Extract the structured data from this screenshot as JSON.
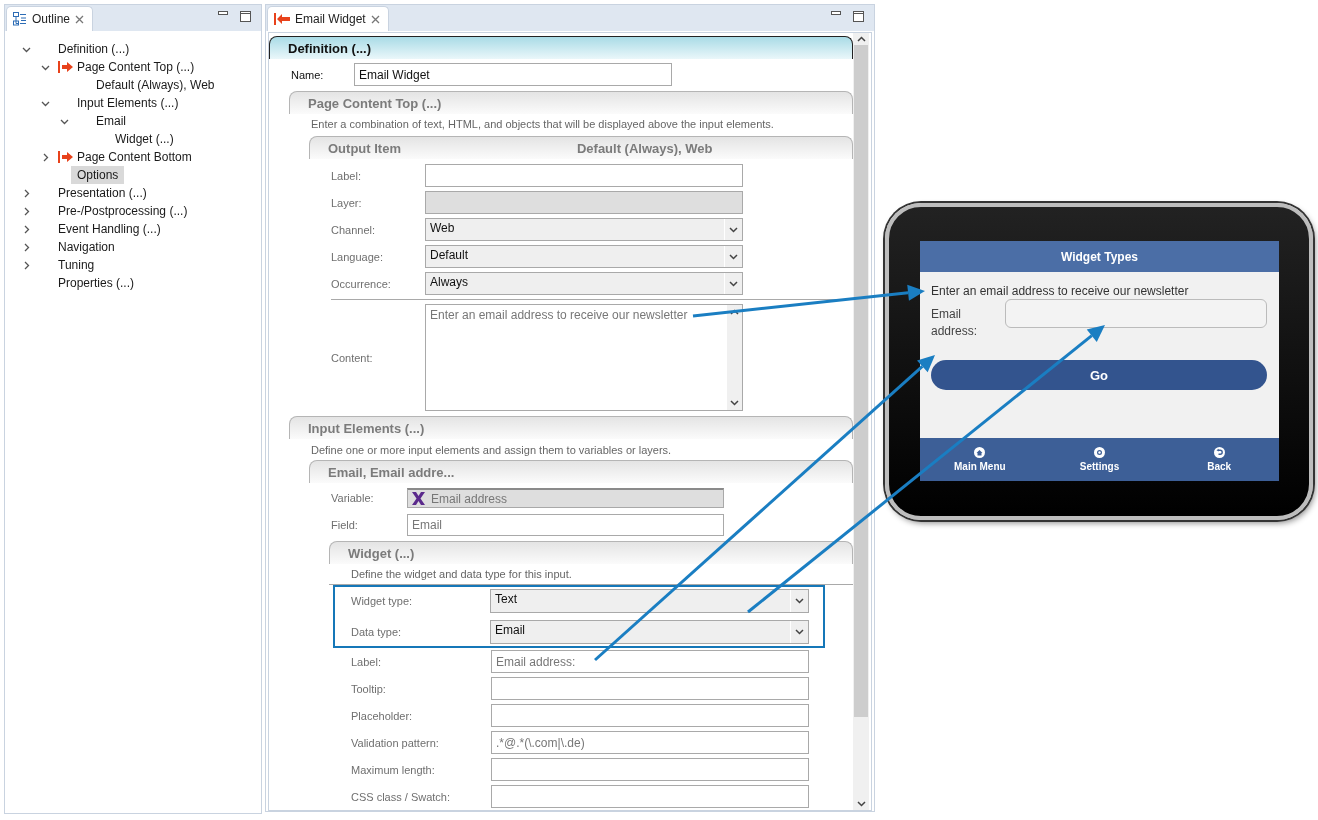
{
  "outline": {
    "title": "Outline",
    "items": [
      {
        "label": "Definition (...)",
        "kind": "branch",
        "expanded": true,
        "marked": false,
        "selected": false,
        "children": [
          {
            "label": "Page Content Top (...)",
            "kind": "branch",
            "expanded": true,
            "marked": true,
            "selected": false,
            "children": [
              {
                "label": "Default (Always), Web",
                "kind": "leaf",
                "marked": false,
                "selected": false
              }
            ]
          },
          {
            "label": "Input Elements (...)",
            "kind": "branch",
            "expanded": true,
            "marked": false,
            "selected": false,
            "children": [
              {
                "label": "Email",
                "kind": "branch",
                "expanded": true,
                "marked": false,
                "selected": false,
                "children": [
                  {
                    "label": "Widget (...)",
                    "kind": "leaf",
                    "marked": false,
                    "selected": false
                  }
                ]
              }
            ]
          },
          {
            "label": "Page Content Bottom",
            "kind": "branch",
            "expanded": false,
            "marked": true,
            "selected": false
          },
          {
            "label": "Options",
            "kind": "leaf",
            "marked": false,
            "selected": true
          }
        ]
      },
      {
        "label": "Presentation (...)",
        "kind": "branch",
        "expanded": false,
        "marked": false,
        "selected": false
      },
      {
        "label": "Pre-/Postprocessing (...)",
        "kind": "branch",
        "expanded": false,
        "marked": false,
        "selected": false
      },
      {
        "label": "Event Handling (...)",
        "kind": "branch",
        "expanded": false,
        "marked": false,
        "selected": false
      },
      {
        "label": "Navigation",
        "kind": "branch",
        "expanded": false,
        "marked": false,
        "selected": false
      },
      {
        "label": "Tuning",
        "kind": "branch",
        "expanded": false,
        "marked": false,
        "selected": false
      },
      {
        "label": "Properties (...)",
        "kind": "leaf",
        "marked": false,
        "selected": false
      }
    ]
  },
  "editor": {
    "tab": {
      "label": "Email Widget"
    },
    "definition": {
      "title": "Definition (...)",
      "name_label": "Name:",
      "name_value": "Email Widget"
    },
    "page_content_top": {
      "title": "Page Content Top (...)",
      "description": "Enter a combination of text, HTML, and objects that will be displayed above the input elements.",
      "output_item": {
        "title": "Output Item",
        "summary": "Default (Always), Web",
        "fields": [
          {
            "label": "Label:",
            "kind": "text"
          },
          {
            "label": "Layer:",
            "kind": "readonly"
          },
          {
            "label": "Channel:",
            "kind": "select",
            "value": "Web"
          },
          {
            "label": "Language:",
            "kind": "select",
            "value": "Default"
          },
          {
            "label": "Occurrence:",
            "kind": "select",
            "value": "Always"
          }
        ],
        "content": {
          "label": "Content:",
          "value": "Enter an email address to receive our newsletter"
        }
      }
    },
    "input_elements": {
      "title": "Input Elements (...)",
      "description": "Define one or more input elements and assign them to variables or layers.",
      "element": {
        "title": "Email, Email addre...",
        "fields": [
          {
            "label": "Variable:",
            "kind": "variable",
            "value": "Email address"
          },
          {
            "label": "Field:",
            "kind": "text",
            "value": "Email"
          }
        ],
        "widget": {
          "title": "Widget (...)",
          "description": "Define the widget and data type for this input.",
          "highlighted_fields": [
            {
              "label": "Widget type:",
              "kind": "select",
              "value": "Text"
            },
            {
              "label": "Data type:",
              "kind": "select",
              "value": "Email"
            }
          ],
          "fields": [
            {
              "label": "Label:",
              "kind": "text",
              "value": "Email address:"
            },
            {
              "label": "Tooltip:",
              "kind": "text"
            },
            {
              "label": "Placeholder:",
              "kind": "text"
            },
            {
              "label": "Validation pattern:",
              "kind": "text",
              "value": ".*@.*(\\.com|\\.de)"
            },
            {
              "label": "Maximum length:",
              "kind": "text"
            },
            {
              "label": "CSS class / Swatch:",
              "kind": "text"
            }
          ]
        }
      }
    }
  },
  "preview": {
    "title": "Widget Types",
    "text": "Enter an email address to receive our newsletter",
    "field_label": "Email address:",
    "button": "Go",
    "nav": [
      {
        "label": "Main Menu",
        "kind": "home"
      },
      {
        "label": "Settings",
        "kind": "settings"
      },
      {
        "label": "Back",
        "kind": "back"
      }
    ]
  }
}
